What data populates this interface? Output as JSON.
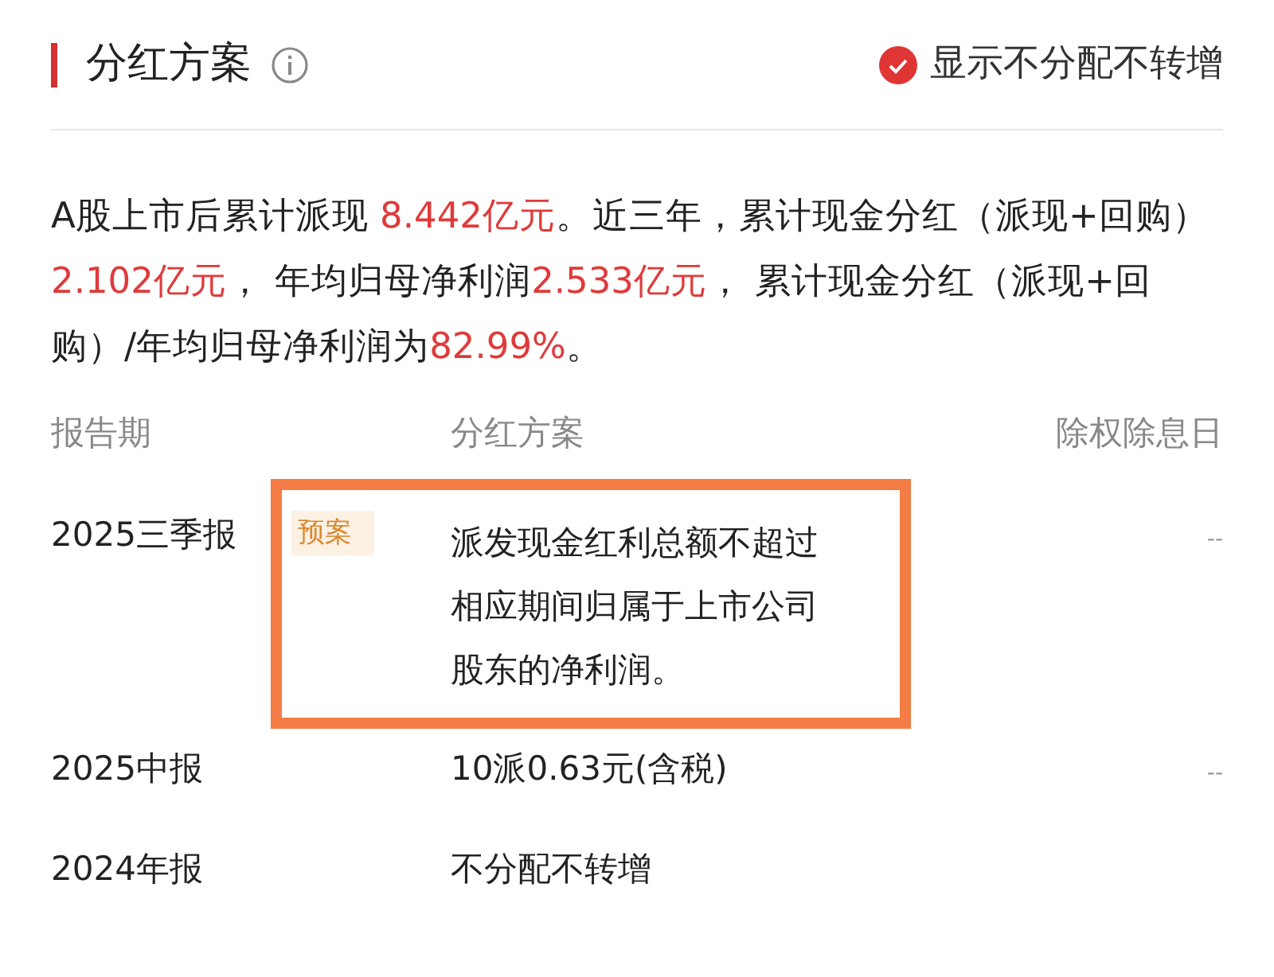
{
  "header": {
    "title": "分红方案",
    "toggle": {
      "label": "显示不分配不转增",
      "checked": true
    }
  },
  "summary": [
    {
      "text": "A股上市后累计派现 ",
      "highlight": false
    },
    {
      "text": "8.442亿元",
      "highlight": true
    },
    {
      "text": "。近三年，累计现金分红（派现+回购）",
      "highlight": false
    },
    {
      "text": "2.102亿元",
      "highlight": true
    },
    {
      "text": "， 年均归母净利润",
      "highlight": false
    },
    {
      "text": "2.533亿元",
      "highlight": true
    },
    {
      "text": "， 累计现金分红（派现+回购）/年均归母净利润为",
      "highlight": false
    },
    {
      "text": "82.99%",
      "highlight": true
    },
    {
      "text": "。",
      "highlight": false
    }
  ],
  "table": {
    "columns": [
      "报告期",
      "分红方案",
      "除权除息日"
    ],
    "rows": [
      {
        "period": "2025三季报",
        "badge": "预案",
        "plan": "派发现金红利总额不超过相应期间归属于上市公司股东的净利润。",
        "date": "--",
        "highlighted": true
      },
      {
        "period": "2025中报",
        "plan": "10派0.63元(含税)",
        "date": "--",
        "highlighted": false
      },
      {
        "period": "2024年报",
        "plan": "不分配不转增",
        "highlighted": false
      }
    ]
  }
}
